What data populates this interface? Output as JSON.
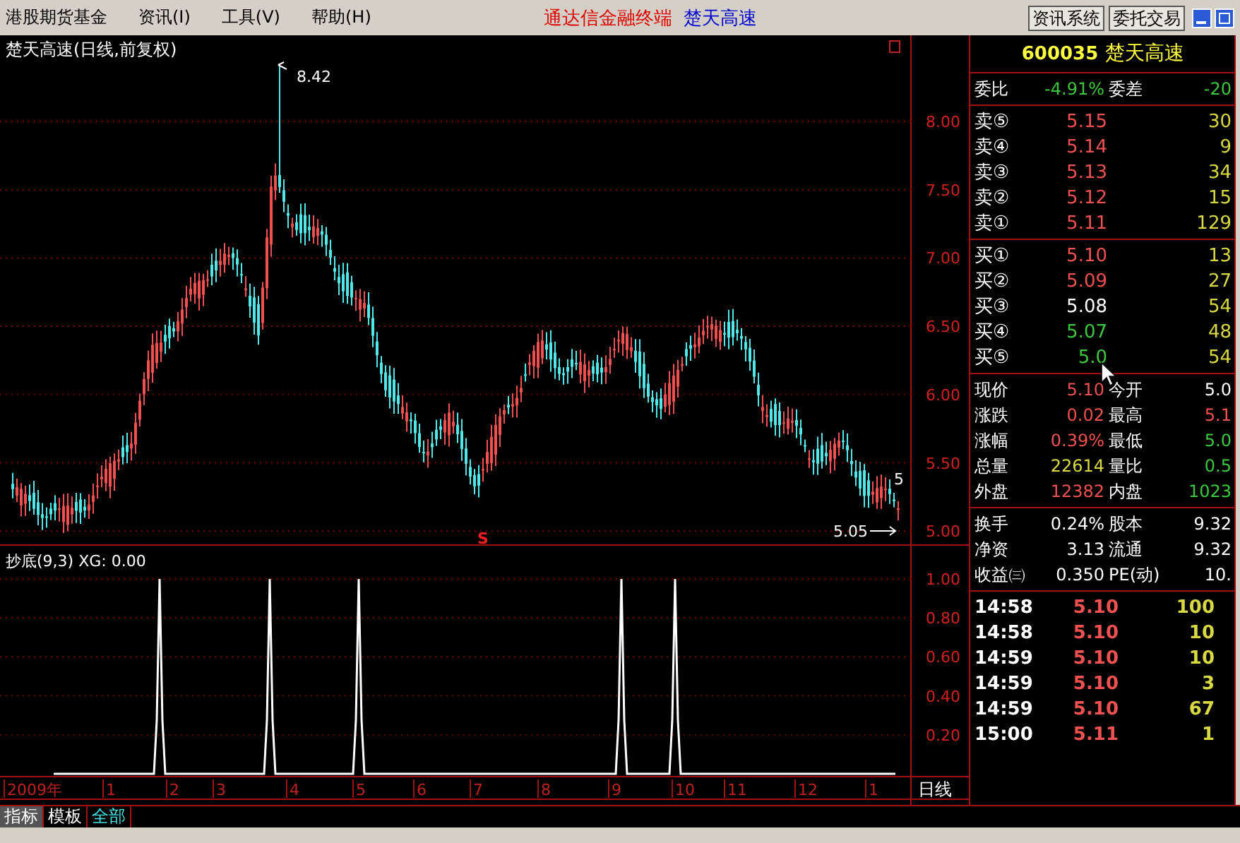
{
  "menu": [
    "港股期货基金",
    "资讯(I)",
    "工具(V)",
    "帮助(H)"
  ],
  "app_title": "通达信金融终端",
  "stock_title": "楚天高速",
  "top_buttons": [
    "资讯系统",
    "委托交易"
  ],
  "chart": {
    "title": "楚天高速(日线,前复权)",
    "price_ticks": [
      "8.00",
      "7.50",
      "7.00",
      "6.50",
      "6.00",
      "5.50",
      "5.00"
    ],
    "high_label": "8.42",
    "low_label": "5.05",
    "last_label": "5",
    "signal_mark": "S",
    "indicator_title": "抄底(9,3)  XG: 0.00",
    "indicator_ticks": [
      "1.00",
      "0.80",
      "0.60",
      "0.40",
      "0.20"
    ],
    "time_labels": [
      "2009年",
      "1",
      "2",
      "3",
      "4",
      "5",
      "6",
      "7",
      "8",
      "9",
      "10",
      "11",
      "12",
      "1"
    ],
    "period": "日线"
  },
  "quote": {
    "code": "600035",
    "name": "楚天高速",
    "ratio": [
      {
        "label": "委比",
        "value": "-4.91%",
        "color": "#3cc83c"
      },
      {
        "label": "委差",
        "value": "-20",
        "color": "#3cc83c"
      }
    ],
    "asks": [
      {
        "label": "卖⑤",
        "price": "5.15",
        "color": "#f05050",
        "volume": "30"
      },
      {
        "label": "卖④",
        "price": "5.14",
        "color": "#f05050",
        "volume": "9"
      },
      {
        "label": "卖③",
        "price": "5.13",
        "color": "#f05050",
        "volume": "34"
      },
      {
        "label": "卖②",
        "price": "5.12",
        "color": "#f05050",
        "volume": "15"
      },
      {
        "label": "卖①",
        "price": "5.11",
        "color": "#f05050",
        "volume": "129"
      }
    ],
    "bids": [
      {
        "label": "买①",
        "price": "5.10",
        "color": "#f05050",
        "volume": "13"
      },
      {
        "label": "买②",
        "price": "5.09",
        "color": "#f05050",
        "volume": "27"
      },
      {
        "label": "买③",
        "price": "5.08",
        "color": "#ffffff",
        "volume": "54"
      },
      {
        "label": "买④",
        "price": "5.07",
        "color": "#3cc83c",
        "volume": "48"
      },
      {
        "label": "买⑤",
        "price": "5.0",
        "color": "#3cc83c",
        "volume": "54"
      }
    ],
    "stats": [
      {
        "label": "现价",
        "value": "5.10",
        "color": "#f05050"
      },
      {
        "label": "今开",
        "value": "5.0",
        "color": "#ffffff"
      },
      {
        "label": "涨跌",
        "value": "0.02",
        "color": "#f05050"
      },
      {
        "label": "最高",
        "value": "5.1",
        "color": "#f05050"
      },
      {
        "label": "涨幅",
        "value": "0.39%",
        "color": "#f05050"
      },
      {
        "label": "最低",
        "value": "5.0",
        "color": "#3cc83c"
      },
      {
        "label": "总量",
        "value": "22614",
        "color": "#d8d840"
      },
      {
        "label": "量比",
        "value": "0.5",
        "color": "#3cc83c"
      },
      {
        "label": "外盘",
        "value": "12382",
        "color": "#f05050"
      },
      {
        "label": "内盘",
        "value": "1023",
        "color": "#3cc83c"
      }
    ],
    "stats2": [
      {
        "label": "换手",
        "value": "0.24%",
        "color": "#ffffff"
      },
      {
        "label": "股本",
        "value": "9.32",
        "color": "#ffffff"
      },
      {
        "label": "净资",
        "value": "3.13",
        "color": "#ffffff"
      },
      {
        "label": "流通",
        "value": "9.32",
        "color": "#ffffff"
      },
      {
        "label": "收益㈢",
        "value": "0.350",
        "color": "#ffffff"
      },
      {
        "label": "PE(动)",
        "value": "10.",
        "color": "#ffffff"
      }
    ],
    "trades": [
      {
        "time": "14:58",
        "price": "5.10",
        "volume": "100"
      },
      {
        "time": "14:58",
        "price": "5.10",
        "volume": "10"
      },
      {
        "time": "14:59",
        "price": "5.10",
        "volume": "10"
      },
      {
        "time": "14:59",
        "price": "5.10",
        "volume": "3"
      },
      {
        "time": "14:59",
        "price": "5.10",
        "volume": "67"
      },
      {
        "time": "15:00",
        "price": "5.11",
        "volume": "1"
      }
    ]
  },
  "tabs": [
    {
      "label": "指标",
      "selected": true
    },
    {
      "label": "模板",
      "selected": false
    },
    {
      "label": "全部",
      "selected": false
    }
  ]
}
